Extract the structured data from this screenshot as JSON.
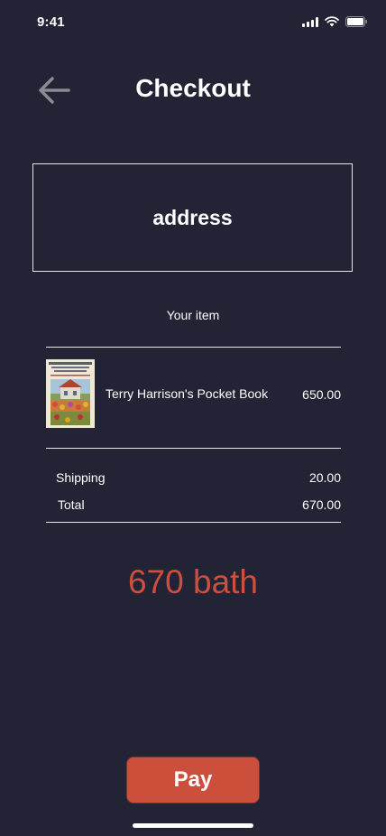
{
  "status_bar": {
    "time": "9:41",
    "icons": [
      "signal-icon",
      "wifi-icon",
      "battery-icon"
    ]
  },
  "header": {
    "title": "Checkout",
    "back_icon": "arrow-left-icon"
  },
  "address": {
    "label": "address"
  },
  "items_section": {
    "heading": "Your item",
    "items": [
      {
        "name": "Terry Harrison's Pocket Book",
        "price": "650.00",
        "cover_icon": "book-cover-image"
      }
    ]
  },
  "summary": {
    "shipping_label": "Shipping",
    "shipping_value": "20.00",
    "total_label": "Total",
    "total_value": "670.00"
  },
  "grand_total": "670 bath",
  "pay_button": {
    "label": "Pay"
  },
  "colors": {
    "background": "#222334",
    "accent": "#cb4f3b",
    "text": "#ffffff"
  }
}
